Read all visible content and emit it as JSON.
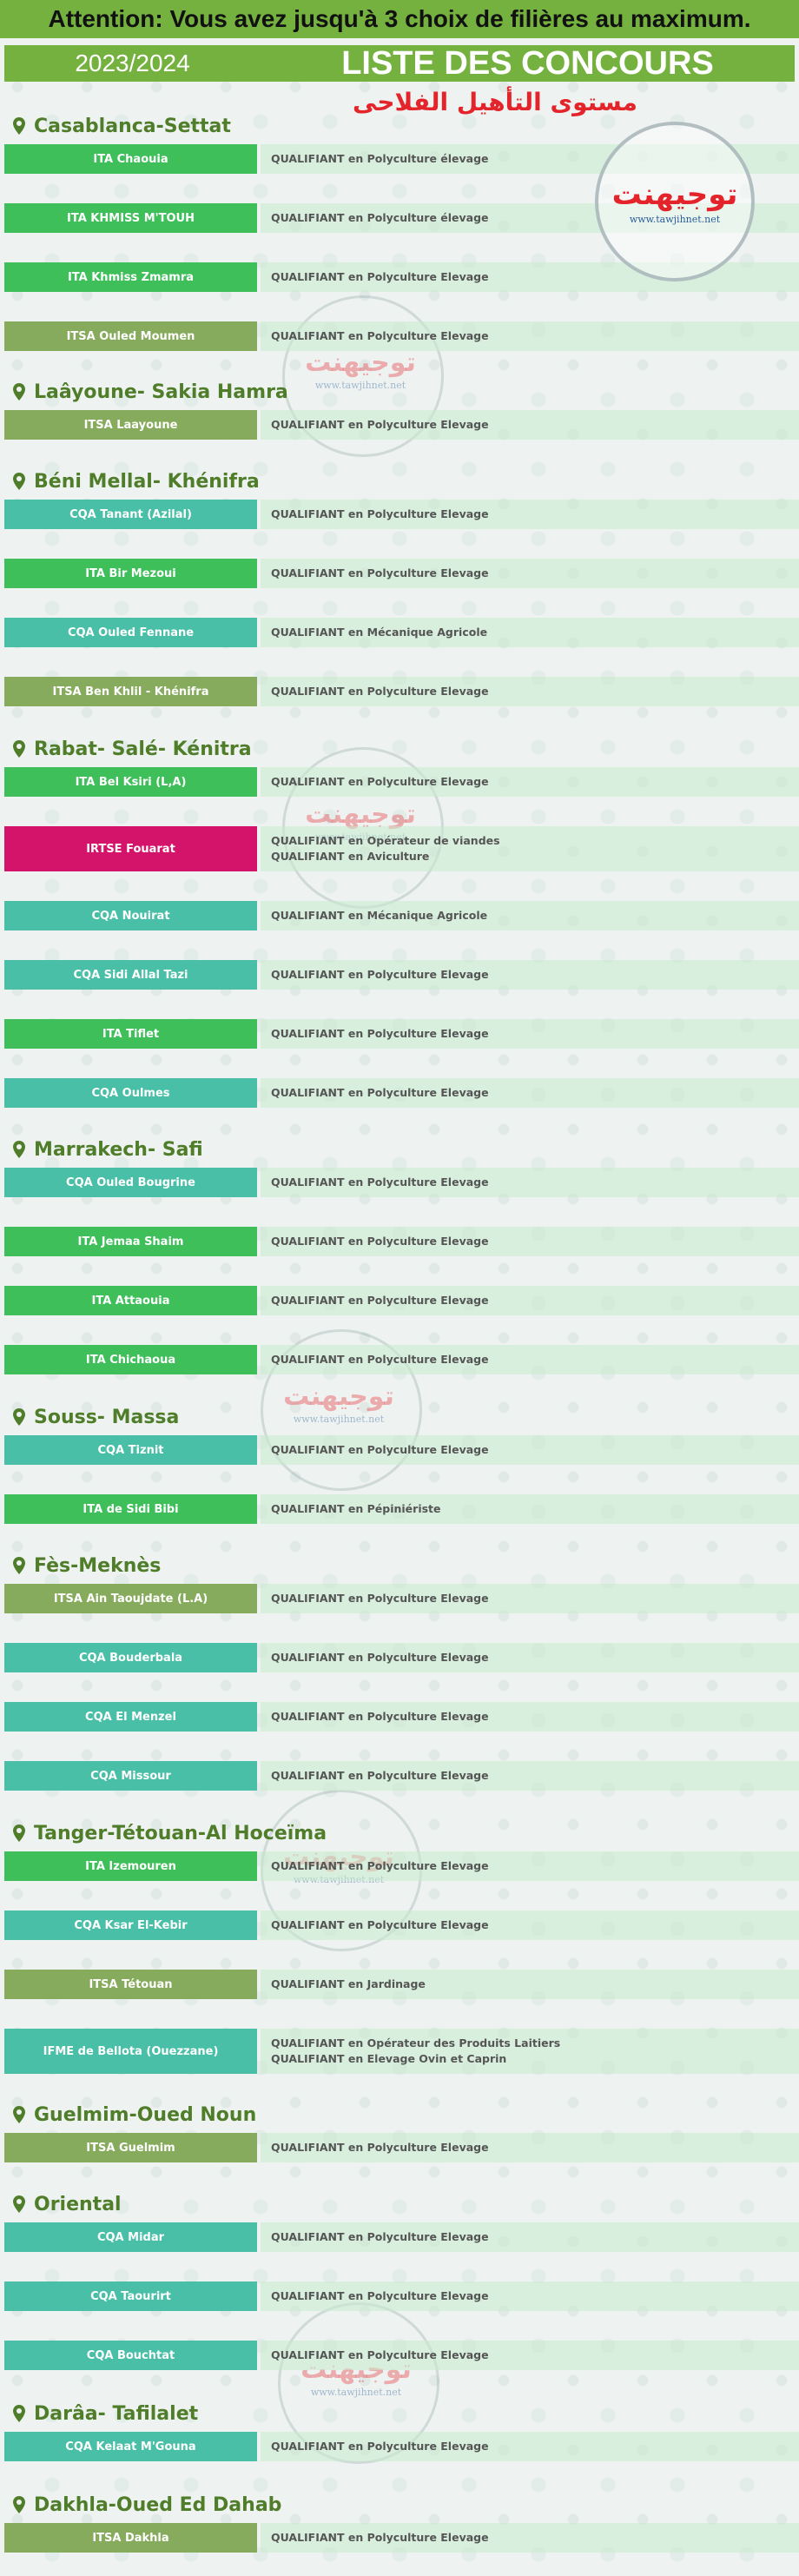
{
  "banner": "Attention: Vous avez jusqu'à 3 choix de filières au maximum.",
  "header": {
    "year": "2023/2024",
    "title": "LISTE DES CONCOURS"
  },
  "subtitle_ar": "مستوى التأهيل الفلاحى",
  "watermark": {
    "arabic": "توجيهنت",
    "url": "www.tawjihnet.net"
  },
  "colors": {
    "ITA": "#3fbf5a",
    "ITSA": "#86ab5c",
    "CQA": "#48bfa6",
    "IRTSE": "#d4146b",
    "IFME": "#48bfa6",
    "region": "#4f7d2a",
    "header": "#74b13e"
  },
  "regions": [
    {
      "name": "Casablanca-Settat",
      "rows": [
        {
          "school": "ITA Chaouia",
          "type": "ITA",
          "filieres": [
            [
              "QUALIFIANT",
              " en Polyculture élevage"
            ]
          ]
        },
        {
          "school": "ITA KHMISS M'TOUH",
          "type": "ITA",
          "filieres": [
            [
              "QUALIFIANT",
              " en Polyculture élevage"
            ]
          ]
        },
        {
          "school": "ITA Khmiss Zmamra",
          "type": "ITA",
          "filieres": [
            [
              "QUALIFIANT",
              " en Polyculture Elevage"
            ]
          ]
        },
        {
          "school": "ITSA Ouled Moumen",
          "type": "ITSA",
          "filieres": [
            [
              "QUALIFIANT",
              " en Polyculture Elevage"
            ]
          ]
        }
      ]
    },
    {
      "name": "Laâyoune- Sakia Hamra",
      "rows": [
        {
          "school": "ITSA Laayoune",
          "type": "ITSA",
          "filieres": [
            [
              "QUALIFIANT",
              " en Polyculture Elevage"
            ]
          ]
        }
      ]
    },
    {
      "name": "Béni Mellal- Khénifra",
      "rows": [
        {
          "school": "CQA Tanant (Azilal)",
          "type": "CQA",
          "filieres": [
            [
              "QUALIFIANT",
              " en Polyculture Elevage"
            ]
          ]
        },
        {
          "school": "ITA Bir Mezoui",
          "type": "ITA",
          "filieres": [
            [
              "QUALIFIANT",
              " en Polyculture Elevage"
            ]
          ]
        },
        {
          "school": "CQA Ouled Fennane",
          "type": "CQA",
          "filieres": [
            [
              "QUALIFIANT",
              " en Mécanique Agricole"
            ]
          ]
        },
        {
          "school": "ITSA Ben Khlil - Khénifra",
          "type": "ITSA",
          "filieres": [
            [
              "QUALIFIANT",
              " en Polyculture Elevage"
            ]
          ]
        }
      ]
    },
    {
      "name": "Rabat- Salé- Kénitra",
      "rows": [
        {
          "school": "ITA Bel Ksiri (L,A)",
          "type": "ITA",
          "filieres": [
            [
              "QUALIFIANT",
              " en Polyculture Elevage"
            ]
          ]
        },
        {
          "school": "IRTSE Fouarat",
          "type": "IRTSE",
          "tall": true,
          "filieres": [
            [
              "QUALIFIANT",
              " en Opérateur de viandes"
            ],
            [
              "QUALIFIANT",
              " en Aviculture"
            ]
          ]
        },
        {
          "school": "CQA Nouirat",
          "type": "CQA",
          "filieres": [
            [
              "QUALIFIANT",
              " en Mécanique Agricole"
            ]
          ]
        },
        {
          "school": "CQA Sidi Allal Tazi",
          "type": "CQA",
          "filieres": [
            [
              "QUALIFIANT",
              " en Polyculture Elevage"
            ]
          ]
        },
        {
          "school": "ITA Tiflet",
          "type": "ITA",
          "filieres": [
            [
              "QUALIFIANT",
              " en Polyculture Elevage"
            ]
          ]
        },
        {
          "school": "CQA Oulmes",
          "type": "CQA",
          "filieres": [
            [
              "QUALIFIANT",
              " en Polyculture Elevage"
            ]
          ]
        }
      ]
    },
    {
      "name": "Marrakech- Safi",
      "rows": [
        {
          "school": "CQA Ouled Bougrine",
          "type": "CQA",
          "filieres": [
            [
              "QUALIFIANT",
              " en Polyculture Elevage"
            ]
          ]
        },
        {
          "school": "ITA Jemaa Shaim",
          "type": "ITA",
          "filieres": [
            [
              "QUALIFIANT",
              " en Polyculture Elevage"
            ]
          ]
        },
        {
          "school": "ITA Attaouia",
          "type": "ITA",
          "filieres": [
            [
              "QUALIFIANT",
              " en Polyculture Elevage"
            ]
          ]
        },
        {
          "school": "ITA Chichaoua",
          "type": "ITA",
          "filieres": [
            [
              "QUALIFIANT",
              " en Polyculture Elevage"
            ]
          ]
        }
      ]
    },
    {
      "name": "Souss- Massa",
      "rows": [
        {
          "school": "CQA Tiznit",
          "type": "CQA",
          "filieres": [
            [
              "QUALIFIANT",
              " en Polyculture Elevage"
            ]
          ]
        },
        {
          "school": "ITA de Sidi Bibi",
          "type": "ITA",
          "filieres": [
            [
              "QUALIFIANT",
              " en Pépiniériste"
            ]
          ]
        }
      ]
    },
    {
      "name": "Fès-Meknès",
      "rows": [
        {
          "school": "ITSA Ain Taoujdate (L.A)",
          "type": "ITSA",
          "filieres": [
            [
              "QUALIFIANT",
              " en Polyculture Elevage"
            ]
          ]
        },
        {
          "school": "CQA Bouderbala",
          "type": "CQA",
          "filieres": [
            [
              "QUALIFIANT",
              " en Polyculture Elevage"
            ]
          ]
        },
        {
          "school": "CQA El Menzel",
          "type": "CQA",
          "filieres": [
            [
              "QUALIFIANT",
              " en Polyculture Elevage"
            ]
          ]
        },
        {
          "school": "CQA Missour",
          "type": "CQA",
          "filieres": [
            [
              "QUALIFIANT",
              " en Polyculture Elevage"
            ]
          ]
        }
      ]
    },
    {
      "name": "Tanger-Tétouan-Al Hoceïma",
      "rows": [
        {
          "school": "ITA Izemouren",
          "type": "ITA",
          "filieres": [
            [
              "QUALIFIANT",
              " en Polyculture Elevage"
            ]
          ]
        },
        {
          "school": "CQA Ksar El-Kebir",
          "type": "CQA",
          "filieres": [
            [
              "QUALIFIANT",
              " en Polyculture Elevage"
            ]
          ]
        },
        {
          "school": "ITSA Tétouan",
          "type": "ITSA",
          "filieres": [
            [
              "QUALIFIANT",
              " en Jardinage"
            ]
          ]
        },
        {
          "school": "IFME de Bellota (Ouezzane)",
          "type": "IFME",
          "tall": true,
          "filieres": [
            [
              "QUALIFIANT",
              " en Opérateur des Produits Laitiers"
            ],
            [
              "QUALIFIANT",
              " en Elevage Ovin et Caprin"
            ]
          ]
        }
      ]
    },
    {
      "name": "Guelmim-Oued Noun",
      "rows": [
        {
          "school": "ITSA Guelmim",
          "type": "ITSA",
          "filieres": [
            [
              "QUALIFIANT",
              " en Polyculture Elevage"
            ]
          ]
        }
      ]
    },
    {
      "name": "Oriental",
      "rows": [
        {
          "school": "CQA Midar",
          "type": "CQA",
          "filieres": [
            [
              "QUALIFIANT",
              " en Polyculture Elevage"
            ]
          ]
        },
        {
          "school": "CQA Taourirt",
          "type": "CQA",
          "filieres": [
            [
              "QUALIFIANT",
              " en Polyculture Elevage"
            ]
          ]
        },
        {
          "school": "CQA Bouchtat",
          "type": "CQA",
          "filieres": [
            [
              "QUALIFIANT",
              " en Polyculture Elevage"
            ]
          ]
        }
      ]
    },
    {
      "name": "Darâa- Tafilalet",
      "rows": [
        {
          "school": "CQA Kelaat M'Gouna",
          "type": "CQA",
          "filieres": [
            [
              "QUALIFIANT",
              " en Polyculture Elevage"
            ]
          ]
        }
      ]
    },
    {
      "name": "Dakhla-Oued Ed Dahab",
      "rows": [
        {
          "school": "ITSA Dakhla",
          "type": "ITSA",
          "filieres": [
            [
              "QUALIFIANT",
              " en Polyculture Elevage"
            ]
          ]
        }
      ]
    }
  ]
}
